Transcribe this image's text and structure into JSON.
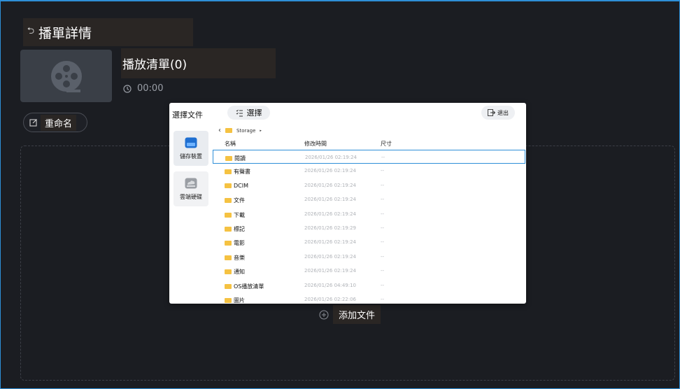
{
  "header": {
    "title": "播單詳情"
  },
  "playlist": {
    "name": "播放清單(0)",
    "duration": "00:00",
    "rename_label": "重命名",
    "add_file_label": "添加文件"
  },
  "dialog": {
    "title": "選擇文件",
    "select_label": "選擇",
    "exit_label": "退出",
    "sidebar": [
      {
        "label": "儲存裝置",
        "icon": "storage-icon"
      },
      {
        "label": "雲端硬碟",
        "icon": "cloud-drive-icon"
      }
    ],
    "breadcrumb": "Storage",
    "columns": [
      "名稱",
      "修改時間",
      "尺寸"
    ],
    "rows": [
      {
        "name": "閱讀",
        "time": "2026/01/26 02:19:24",
        "size": "--"
      },
      {
        "name": "有聲書",
        "time": "2026/01/26 02:19:24",
        "size": "--"
      },
      {
        "name": "DCIM",
        "time": "2026/01/26 02:19:24",
        "size": "--"
      },
      {
        "name": "文件",
        "time": "2026/01/26 02:19:24",
        "size": "--"
      },
      {
        "name": "下載",
        "time": "2026/01/26 02:19:24",
        "size": "--"
      },
      {
        "name": "標記",
        "time": "2026/01/26 02:19:29",
        "size": "--"
      },
      {
        "name": "電影",
        "time": "2026/01/26 02:19:24",
        "size": "--"
      },
      {
        "name": "音樂",
        "time": "2026/01/26 02:19:24",
        "size": "--"
      },
      {
        "name": "通知",
        "time": "2026/01/26 02:19:24",
        "size": "--"
      },
      {
        "name": "OS播放清單",
        "time": "2026/01/26 04:49:10",
        "size": "--"
      },
      {
        "name": "圖片",
        "time": "2026/01/26 02:22:06",
        "size": "--"
      }
    ]
  },
  "colors": {
    "accent": "#2e8fd8",
    "folder": "#f5c242",
    "background": "#1b1d22"
  }
}
